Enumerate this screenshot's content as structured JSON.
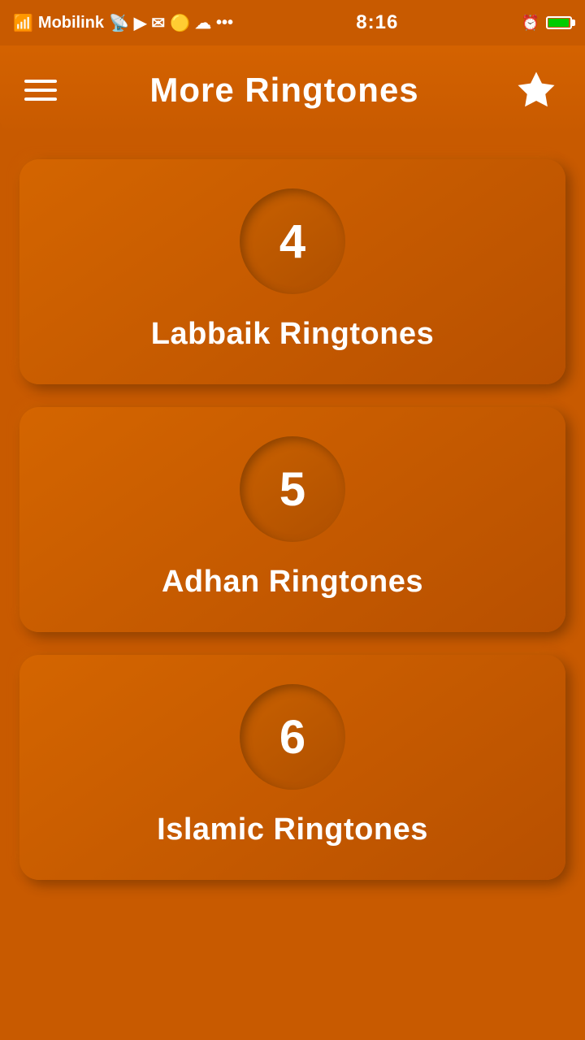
{
  "status_bar": {
    "carrier": "Mobilink",
    "time": "8:16"
  },
  "nav": {
    "title": "More Ringtones",
    "menu_icon": "hamburger-icon",
    "star_icon": "star-icon"
  },
  "cards": [
    {
      "number": "4",
      "label": "Labbaik Ringtones"
    },
    {
      "number": "5",
      "label": "Adhan Ringtones"
    },
    {
      "number": "6",
      "label": "Islamic Ringtones"
    }
  ]
}
